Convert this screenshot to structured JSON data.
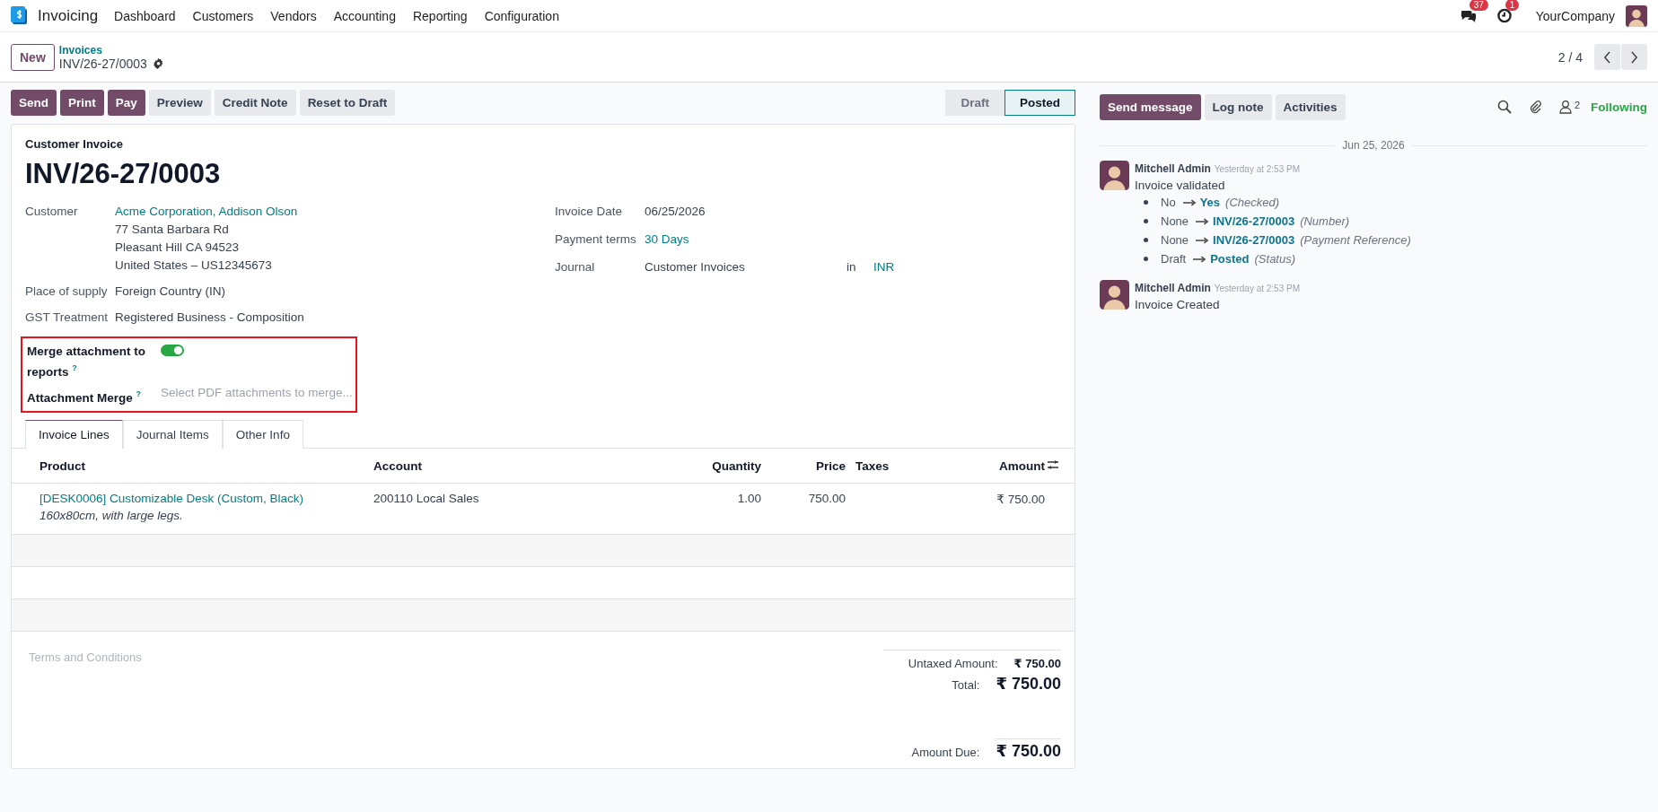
{
  "navbar": {
    "app_name": "Invoicing",
    "menus": [
      "Dashboard",
      "Customers",
      "Vendors",
      "Accounting",
      "Reporting",
      "Configuration"
    ],
    "messages_count": "37",
    "activities_count": "1",
    "company": "YourCompany"
  },
  "control_panel": {
    "new_button": "New",
    "breadcrumb_parent": "Invoices",
    "breadcrumb_current": "INV/26-27/0003",
    "pager": "2 / 4"
  },
  "actions": [
    {
      "label": "Send",
      "kind": "primary"
    },
    {
      "label": "Print",
      "kind": "primary"
    },
    {
      "label": "Pay",
      "kind": "primary"
    },
    {
      "label": "Preview",
      "kind": "secondary"
    },
    {
      "label": "Credit Note",
      "kind": "secondary"
    },
    {
      "label": "Reset to Draft",
      "kind": "secondary"
    }
  ],
  "status_steps": [
    {
      "label": "Draft",
      "selected": false
    },
    {
      "label": "Posted",
      "selected": true
    }
  ],
  "form": {
    "type_label": "Customer Invoice",
    "number": "INV/26-27/0003",
    "left_fields": [
      {
        "label": "Customer",
        "kind": "link",
        "lines": [
          "Acme Corporation, Addison Olson",
          "77 Santa Barbara Rd",
          "Pleasant Hill CA 94523",
          "United States – US12345673"
        ]
      },
      {
        "label": "Place of supply",
        "kind": "text",
        "lines": [
          "Foreign Country (IN)"
        ]
      },
      {
        "label": "GST Treatment",
        "kind": "text",
        "lines": [
          "Registered Business - Composition"
        ]
      }
    ],
    "highlighted_fields": {
      "highlighted": true,
      "merge_label": "Merge attachment to reports",
      "merge_help": "?",
      "merge_on": true,
      "attachment_label": "Attachment Merge",
      "attachment_help": "?",
      "attachment_placeholder": "Select PDF attachments to merge..."
    },
    "right_fields": [
      {
        "label": "Invoice Date",
        "kind": "text",
        "value": "06/25/2026"
      },
      {
        "label": "Payment terms",
        "kind": "link",
        "value": "30 Days"
      },
      {
        "label": "Journal",
        "kind": "journal",
        "value": "Customer Invoices",
        "connector": "in",
        "currency": "INR"
      }
    ],
    "tabs": [
      {
        "label": "Invoice Lines",
        "selected": true
      },
      {
        "label": "Journal Items",
        "selected": false
      },
      {
        "label": "Other Info",
        "selected": false
      }
    ],
    "table": {
      "columns": [
        "Product",
        "Account",
        "Quantity",
        "Price",
        "Taxes",
        "Amount"
      ],
      "rows": [
        {
          "product": "[DESK0006] Customizable Desk (Custom, Black)",
          "description": "160x80cm, with large legs.",
          "account": "200110 Local Sales",
          "quantity": "1.00",
          "price": "750.00",
          "amount": "₹ 750.00"
        }
      ]
    },
    "terms_placeholder": "Terms and Conditions",
    "totals": {
      "untaxed_label": "Untaxed Amount:",
      "untaxed": "₹ 750.00",
      "total_label": "Total:",
      "total": "₹ 750.00",
      "due_label": "Amount Due:",
      "due": "₹ 750.00"
    }
  },
  "chatter": {
    "buttons": [
      {
        "label": "Send message",
        "kind": "primary"
      },
      {
        "label": "Log note",
        "kind": "secondary"
      },
      {
        "label": "Activities",
        "kind": "secondary"
      }
    ],
    "followers_count": "2",
    "follow_status": "Following",
    "date": "Jun 25, 2026",
    "messages": [
      {
        "author": "Mitchell Admin",
        "time": "Yesterday at 2:53 PM",
        "body": "Invoice validated",
        "changes": [
          {
            "old": "No",
            "new": "Yes",
            "field": "(Checked)"
          },
          {
            "old": "None",
            "new": "INV/26-27/0003",
            "field": "(Number)"
          },
          {
            "old": "None",
            "new": "INV/26-27/0003",
            "field": "(Payment Reference)"
          },
          {
            "old": "Draft",
            "new": "Posted",
            "field": "(Status)"
          }
        ]
      },
      {
        "author": "Mitchell Admin",
        "time": "Yesterday at 2:53 PM",
        "body": "Invoice Created"
      }
    ]
  }
}
